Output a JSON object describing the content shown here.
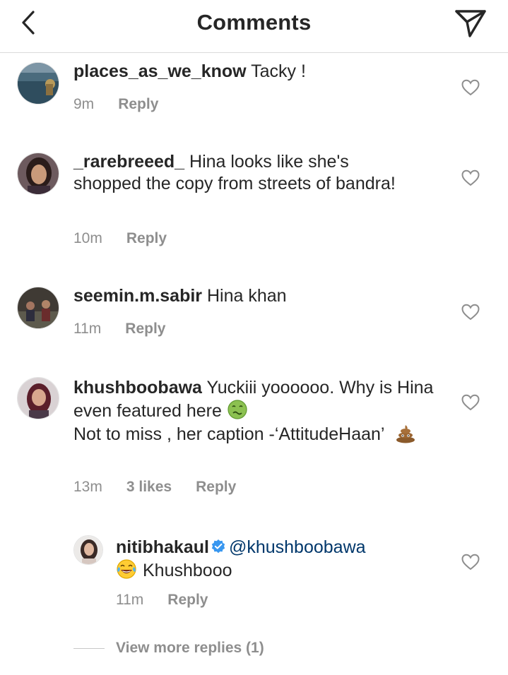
{
  "header": {
    "title": "Comments"
  },
  "comments": [
    {
      "username": "places_as_we_know",
      "text": "Tacky !",
      "time": "9m",
      "reply": "Reply"
    },
    {
      "username": "_rarebreeed_",
      "text": "Hina looks like she's shopped the copy from streets of bandra!",
      "time": "10m",
      "reply": "Reply"
    },
    {
      "username": "seemin.m.sabir",
      "text": "Hina khan",
      "time": "11m",
      "reply": "Reply"
    },
    {
      "username": "khushboobawa",
      "text_line1": "Yuckiii yoooooo. Why is Hina even featured here",
      "text_line2": "Not to miss , her caption -‘AttitudeHaan’",
      "time": "13m",
      "likes": "3 likes",
      "reply": "Reply"
    }
  ],
  "reply_comment": {
    "username": "nitibhakaul",
    "mention": "@khushboobawa",
    "text": "Khushbooo",
    "time": "11m",
    "reply": "Reply"
  },
  "view_more": "View more replies (1)",
  "icons": {
    "back": "chevron-left-icon",
    "send": "paper-plane-icon",
    "like": "heart-outline-icon",
    "verified": "verified-badge-icon",
    "emoji_sick": "nauseated-face-emoji",
    "emoji_poop": "pile-of-poo-emoji",
    "emoji_laugh": "tears-of-joy-emoji"
  },
  "colors": {
    "text": "#262626",
    "secondary": "#8e8e8e",
    "mention": "#00376b",
    "verified": "#3897f0",
    "divider": "#dbdbdb"
  }
}
